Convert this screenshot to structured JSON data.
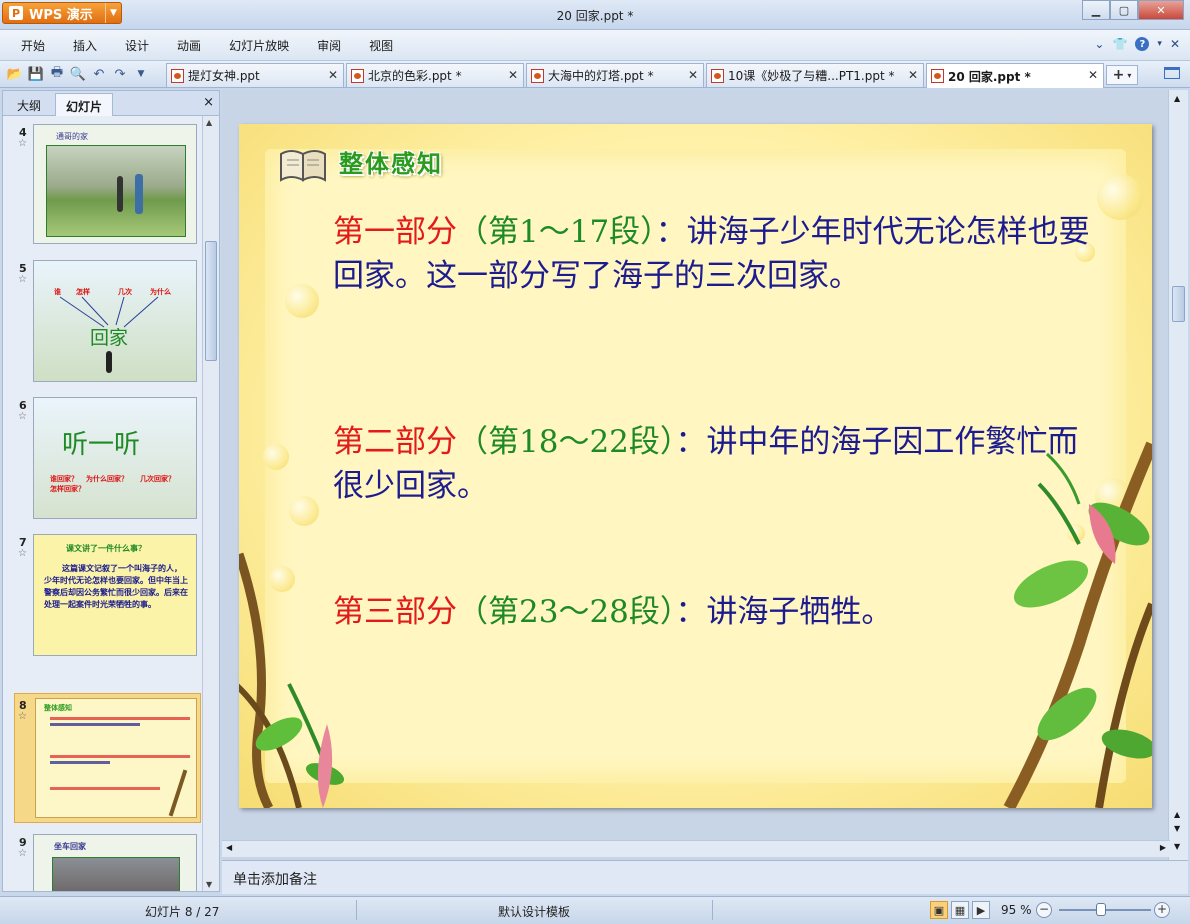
{
  "window": {
    "app_button": "WPS 演示",
    "title": "20 回家.ppt *"
  },
  "menu": [
    "开始",
    "插入",
    "设计",
    "动画",
    "幻灯片放映",
    "审阅",
    "视图"
  ],
  "doc_tabs": [
    {
      "label": "提灯女神.ppt"
    },
    {
      "label": "北京的色彩.ppt *"
    },
    {
      "label": "大海中的灯塔.ppt *"
    },
    {
      "label": "10课《妙极了与糟...PT1.ppt *"
    },
    {
      "label": "20 回家.ppt *"
    }
  ],
  "pane": {
    "tabs": [
      "大纲",
      "幻灯片"
    ],
    "close": "×"
  },
  "thumbnails": [
    {
      "num": "4",
      "text": "通哥的家"
    },
    {
      "num": "5",
      "words": [
        "谁",
        "怎样",
        "几次",
        "为什么"
      ],
      "center": "回家"
    },
    {
      "num": "6",
      "title": "听一听",
      "line1": "谁回家？",
      "line1b": "为什么回家？",
      "line1c": "几次回家？",
      "line2": "怎样回家？"
    },
    {
      "num": "7",
      "title": "课文讲了一件什么事？",
      "body": "这篇课文记叙了一个叫海子的人，少年时代无论怎样也要回家。但中年当上警察后却因公务繁忙而很少回家。后来在处理一起案件时光荣牺牲的事。"
    },
    {
      "num": "8",
      "title": "整体感知"
    },
    {
      "num": "9",
      "text": "坐车回家"
    }
  ],
  "slide": {
    "title": "整体感知",
    "parts": [
      {
        "label": "第一部分",
        "range": "（第1～17段）",
        "colon": "：",
        "text": "讲海子少年时代无论怎样也要回家。这一部分写了海子的三次回家。"
      },
      {
        "label": "第二部分",
        "range": "（第18～22段）",
        "colon": "：",
        "text": "讲中年的海子因工作繁忙而很少回家。"
      },
      {
        "label": "第三部分",
        "range": "（第23～28段）",
        "colon": "：",
        "text": "讲海子牺牲。"
      }
    ]
  },
  "notes_placeholder": "单击添加备注",
  "status": {
    "slide_info": "幻灯片 8 / 27",
    "template": "默认设计模板",
    "zoom": "95 %"
  },
  "colors": {
    "label_red": "#e21a1a",
    "range_green": "#1e8a25",
    "text_navy": "#1c1c8f"
  }
}
